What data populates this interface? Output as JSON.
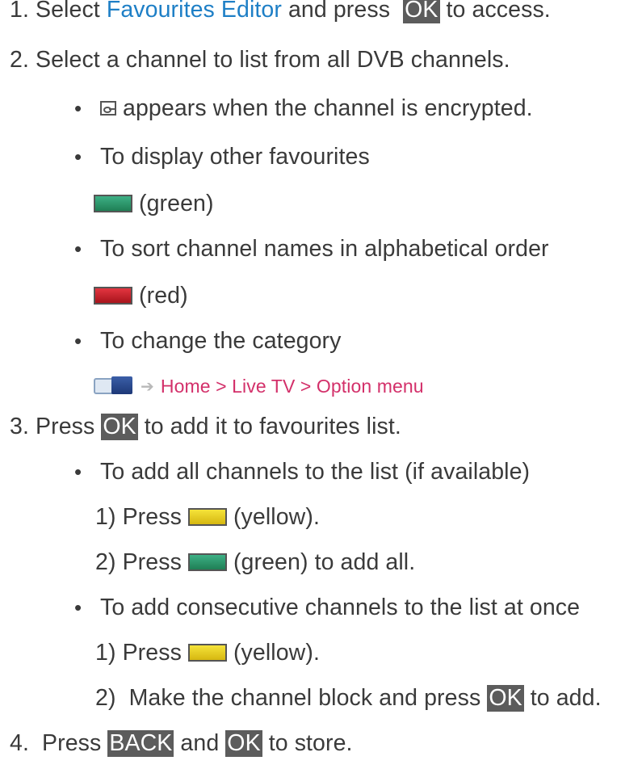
{
  "steps": [
    {
      "num": "1.",
      "pre": "Select ",
      "link": "Favourites Editor",
      "mid": " and press ",
      "key": "OK",
      "post": " to access."
    },
    {
      "num": "2.",
      "text": "Select a channel to list from all DVB channels."
    },
    {
      "num": "3.",
      "pre": "Press ",
      "key": "OK",
      "post": " to add it to favourites list."
    },
    {
      "num": "4.",
      "pre": "Press ",
      "key1": "BACK",
      "mid": " and ",
      "key2": "OK",
      "post": " to store."
    }
  ],
  "bullets": {
    "encrypted": "appears when the channel is encrypted.",
    "other_favourites": "To display other favourites",
    "green_label": " (green)",
    "sort": "To sort channel names in alphabetical order",
    "red_label": " (red)",
    "category": "To change the category",
    "nav_path": "Home > Live TV > Option menu",
    "add_all": "To add all channels to the list (if available)",
    "add_consecutive": "To add consecutive channels to the list at once"
  },
  "substeps": {
    "a1_num": "1)",
    "a1_pre": "Press ",
    "a1_post": " (yellow).",
    "a2_num": "2)",
    "a2_pre": "Press ",
    "a2_post": " (green) to add all.",
    "b1_num": "1)",
    "b1_pre": "Press ",
    "b1_post": " (yellow).",
    "b2_num": "2)",
    "b2_pre": "Make the channel block and press ",
    "b2_key": "OK",
    "b2_post": " to add."
  },
  "icons": {
    "lock": "encrypted-lock-icon",
    "green": "green-button-icon",
    "red": "red-button-icon",
    "yellow": "yellow-button-icon",
    "nav": "home-nav-icon",
    "arrow": "arrow-right-icon"
  },
  "colors": {
    "link_blue": "#1e7fc6",
    "link_pink": "#d3306a",
    "key_bg": "#5c5c5c",
    "green": "#2a9a6a",
    "red": "#c81e28",
    "yellow": "#e8cc20"
  }
}
